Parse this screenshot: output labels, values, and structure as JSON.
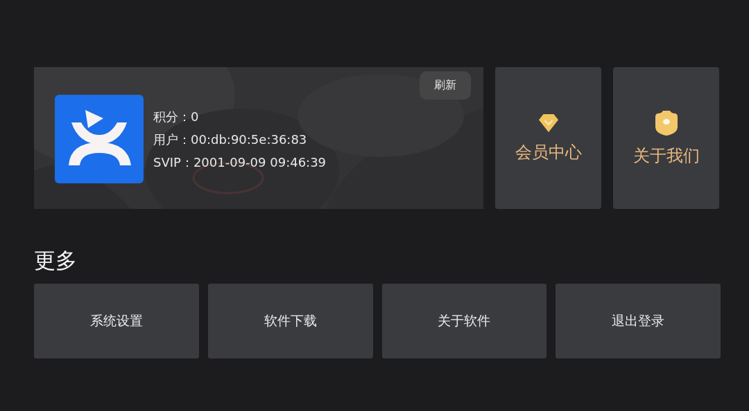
{
  "profile": {
    "refresh_button": "刷新",
    "info": [
      "积分：0",
      "用户：00:db:90:5e:36:83",
      "SVIP：2001-09-09 09:46:39"
    ]
  },
  "tiles": [
    {
      "kind": "diamond",
      "label": "会员中心"
    },
    {
      "kind": "badge",
      "label": "关于我们"
    }
  ],
  "more": {
    "title": "更多",
    "buttons": [
      "系统设置",
      "软件下载",
      "关于软件",
      "退出登录"
    ]
  }
}
